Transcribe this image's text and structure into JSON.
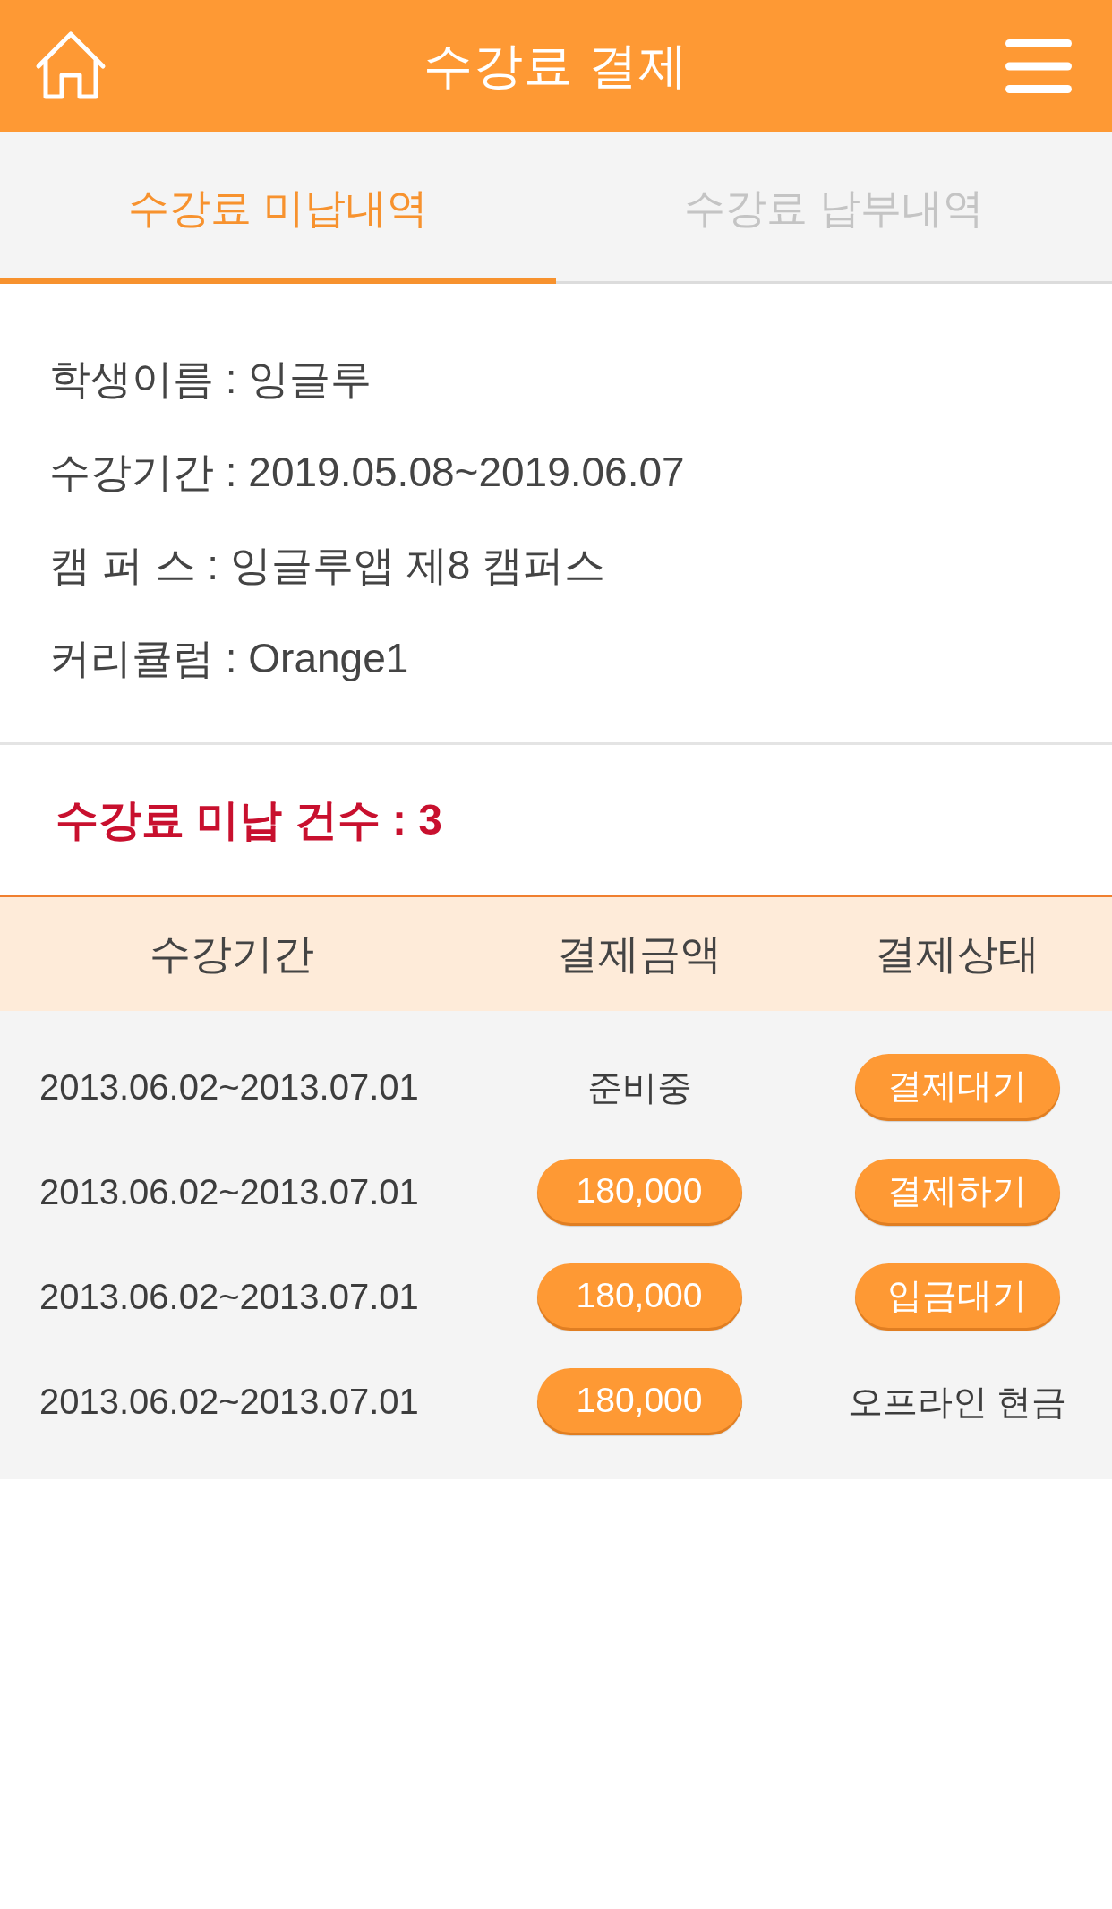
{
  "header": {
    "title": "수강료 결제"
  },
  "tabs": [
    {
      "label": "수강료 미납내역",
      "selected": true
    },
    {
      "label": "수강료 납부내역",
      "selected": false
    }
  ],
  "student_info": [
    "학생이름 : 잉글루",
    "수강기간 : 2019.05.08~2019.06.07",
    "캠 퍼 스 : 잉글루앱 제8 캠퍼스",
    "커리큘럼 : Orange1"
  ],
  "unpaid_count": "수강료 미납 건수 : 3",
  "table": {
    "columns": [
      "수강기간",
      "결제금액",
      "결제상태"
    ],
    "rows": [
      {
        "period": "2013.06.02~2013.07.01",
        "amount": {
          "kind": "text",
          "text": "준비중"
        },
        "status": {
          "kind": "pill",
          "text": "결제대기"
        }
      },
      {
        "period": "2013.06.02~2013.07.01",
        "amount": {
          "kind": "pill",
          "text": "180,000"
        },
        "status": {
          "kind": "pill",
          "text": "결제하기"
        }
      },
      {
        "period": "2013.06.02~2013.07.01",
        "amount": {
          "kind": "pill",
          "text": "180,000"
        },
        "status": {
          "kind": "pill",
          "text": "입금대기"
        }
      },
      {
        "period": "2013.06.02~2013.07.01",
        "amount": {
          "kind": "pill",
          "text": "180,000"
        },
        "status": {
          "kind": "text",
          "text": "오프라인 현금"
        }
      }
    ]
  }
}
